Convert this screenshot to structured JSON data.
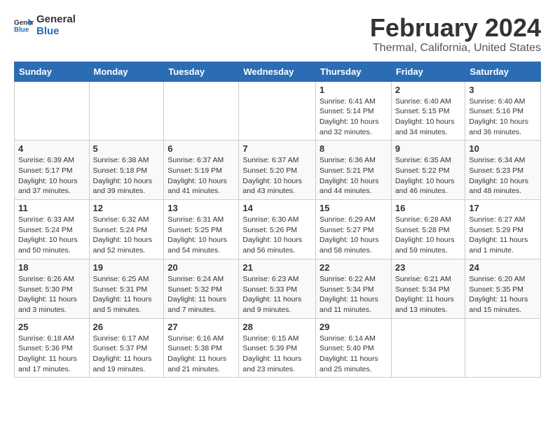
{
  "header": {
    "logo_line1": "General",
    "logo_line2": "Blue",
    "main_title": "February 2024",
    "subtitle": "Thermal, California, United States"
  },
  "columns": [
    "Sunday",
    "Monday",
    "Tuesday",
    "Wednesday",
    "Thursday",
    "Friday",
    "Saturday"
  ],
  "weeks": [
    [
      {
        "day": "",
        "info": ""
      },
      {
        "day": "",
        "info": ""
      },
      {
        "day": "",
        "info": ""
      },
      {
        "day": "",
        "info": ""
      },
      {
        "day": "1",
        "info": "Sunrise: 6:41 AM\nSunset: 5:14 PM\nDaylight: 10 hours\nand 32 minutes."
      },
      {
        "day": "2",
        "info": "Sunrise: 6:40 AM\nSunset: 5:15 PM\nDaylight: 10 hours\nand 34 minutes."
      },
      {
        "day": "3",
        "info": "Sunrise: 6:40 AM\nSunset: 5:16 PM\nDaylight: 10 hours\nand 36 minutes."
      }
    ],
    [
      {
        "day": "4",
        "info": "Sunrise: 6:39 AM\nSunset: 5:17 PM\nDaylight: 10 hours\nand 37 minutes."
      },
      {
        "day": "5",
        "info": "Sunrise: 6:38 AM\nSunset: 5:18 PM\nDaylight: 10 hours\nand 39 minutes."
      },
      {
        "day": "6",
        "info": "Sunrise: 6:37 AM\nSunset: 5:19 PM\nDaylight: 10 hours\nand 41 minutes."
      },
      {
        "day": "7",
        "info": "Sunrise: 6:37 AM\nSunset: 5:20 PM\nDaylight: 10 hours\nand 43 minutes."
      },
      {
        "day": "8",
        "info": "Sunrise: 6:36 AM\nSunset: 5:21 PM\nDaylight: 10 hours\nand 44 minutes."
      },
      {
        "day": "9",
        "info": "Sunrise: 6:35 AM\nSunset: 5:22 PM\nDaylight: 10 hours\nand 46 minutes."
      },
      {
        "day": "10",
        "info": "Sunrise: 6:34 AM\nSunset: 5:23 PM\nDaylight: 10 hours\nand 48 minutes."
      }
    ],
    [
      {
        "day": "11",
        "info": "Sunrise: 6:33 AM\nSunset: 5:24 PM\nDaylight: 10 hours\nand 50 minutes."
      },
      {
        "day": "12",
        "info": "Sunrise: 6:32 AM\nSunset: 5:24 PM\nDaylight: 10 hours\nand 52 minutes."
      },
      {
        "day": "13",
        "info": "Sunrise: 6:31 AM\nSunset: 5:25 PM\nDaylight: 10 hours\nand 54 minutes."
      },
      {
        "day": "14",
        "info": "Sunrise: 6:30 AM\nSunset: 5:26 PM\nDaylight: 10 hours\nand 56 minutes."
      },
      {
        "day": "15",
        "info": "Sunrise: 6:29 AM\nSunset: 5:27 PM\nDaylight: 10 hours\nand 58 minutes."
      },
      {
        "day": "16",
        "info": "Sunrise: 6:28 AM\nSunset: 5:28 PM\nDaylight: 10 hours\nand 59 minutes."
      },
      {
        "day": "17",
        "info": "Sunrise: 6:27 AM\nSunset: 5:29 PM\nDaylight: 11 hours\nand 1 minute."
      }
    ],
    [
      {
        "day": "18",
        "info": "Sunrise: 6:26 AM\nSunset: 5:30 PM\nDaylight: 11 hours\nand 3 minutes."
      },
      {
        "day": "19",
        "info": "Sunrise: 6:25 AM\nSunset: 5:31 PM\nDaylight: 11 hours\nand 5 minutes."
      },
      {
        "day": "20",
        "info": "Sunrise: 6:24 AM\nSunset: 5:32 PM\nDaylight: 11 hours\nand 7 minutes."
      },
      {
        "day": "21",
        "info": "Sunrise: 6:23 AM\nSunset: 5:33 PM\nDaylight: 11 hours\nand 9 minutes."
      },
      {
        "day": "22",
        "info": "Sunrise: 6:22 AM\nSunset: 5:34 PM\nDaylight: 11 hours\nand 11 minutes."
      },
      {
        "day": "23",
        "info": "Sunrise: 6:21 AM\nSunset: 5:34 PM\nDaylight: 11 hours\nand 13 minutes."
      },
      {
        "day": "24",
        "info": "Sunrise: 6:20 AM\nSunset: 5:35 PM\nDaylight: 11 hours\nand 15 minutes."
      }
    ],
    [
      {
        "day": "25",
        "info": "Sunrise: 6:18 AM\nSunset: 5:36 PM\nDaylight: 11 hours\nand 17 minutes."
      },
      {
        "day": "26",
        "info": "Sunrise: 6:17 AM\nSunset: 5:37 PM\nDaylight: 11 hours\nand 19 minutes."
      },
      {
        "day": "27",
        "info": "Sunrise: 6:16 AM\nSunset: 5:38 PM\nDaylight: 11 hours\nand 21 minutes."
      },
      {
        "day": "28",
        "info": "Sunrise: 6:15 AM\nSunset: 5:39 PM\nDaylight: 11 hours\nand 23 minutes."
      },
      {
        "day": "29",
        "info": "Sunrise: 6:14 AM\nSunset: 5:40 PM\nDaylight: 11 hours\nand 25 minutes."
      },
      {
        "day": "",
        "info": ""
      },
      {
        "day": "",
        "info": ""
      }
    ]
  ]
}
